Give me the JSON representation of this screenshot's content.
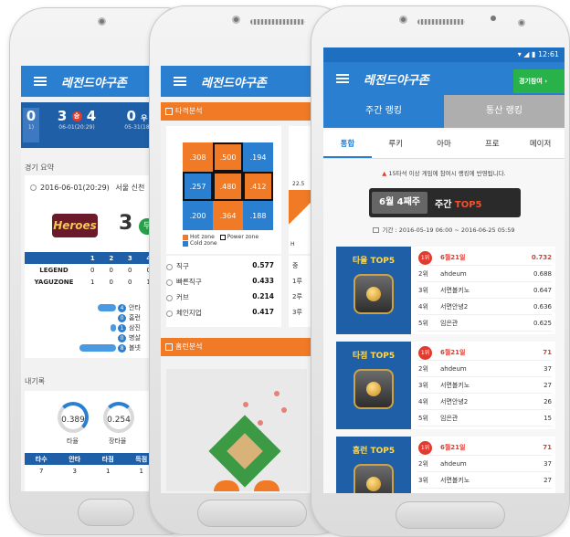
{
  "brand": "레전드야구존",
  "phone1": {
    "score_cards": [
      {
        "score": "0",
        "date": "1)"
      },
      {
        "score_left": "3",
        "result": "승",
        "score_right": "4",
        "date": "06-01(20:29)"
      },
      {
        "score": "0",
        "result": "우",
        "date": "05-31(18"
      }
    ],
    "summary_label": "경기 요약",
    "game_datetime": "2016-06-01(20:29)",
    "game_place": "서울 신천",
    "team_logo": "Heroes",
    "team_score": "3",
    "team_result": "무",
    "innings": [
      "1",
      "2",
      "3",
      "4"
    ],
    "box_rows": [
      {
        "team": "LEGEND",
        "scores": [
          "0",
          "0",
          "0",
          "0"
        ]
      },
      {
        "team": "YAGUZONE",
        "scores": [
          "1",
          "0",
          "0",
          "1"
        ]
      }
    ],
    "stat_legend": [
      {
        "count": "4",
        "label": "안타",
        "fill": 0.5
      },
      {
        "count": "0",
        "label": "홈런",
        "fill": 0
      },
      {
        "count": "1",
        "label": "삼진",
        "fill": 0.15
      },
      {
        "count": "0",
        "label": "병살",
        "fill": 0
      },
      {
        "count": "8",
        "label": "볼넷",
        "fill": 1
      }
    ],
    "my_record_label": "내기록",
    "rings": [
      {
        "value": "0.389",
        "label": "타율"
      },
      {
        "value": "0.254",
        "label": "장타율"
      }
    ],
    "record_headers": [
      "타수",
      "안타",
      "타점",
      "득점"
    ],
    "record_values": [
      "7",
      "3",
      "1",
      "1"
    ]
  },
  "phone2": {
    "batting_section": "타격분석",
    "zones": [
      {
        "value": ".308",
        "type": "hot",
        "power": false
      },
      {
        "value": ".500",
        "type": "hot",
        "power": true
      },
      {
        "value": ".194",
        "type": "cold",
        "power": false
      },
      {
        "value": ".257",
        "type": "cold",
        "power": true
      },
      {
        "value": ".480",
        "type": "hot",
        "power": true
      },
      {
        "value": ".412",
        "type": "hot",
        "power": true
      },
      {
        "value": ".200",
        "type": "cold",
        "power": false
      },
      {
        "value": ".364",
        "type": "hot",
        "power": false
      },
      {
        "value": ".188",
        "type": "cold",
        "power": false
      }
    ],
    "zone_legend": {
      "hot": "Hot zone",
      "power": "Power zone",
      "cold": "Cold zone"
    },
    "pitch_stats": [
      {
        "label": "직구",
        "value": "0.577"
      },
      {
        "label": "빠른직구",
        "value": "0.433"
      },
      {
        "label": "커브",
        "value": "0.214"
      },
      {
        "label": "체인지업",
        "value": "0.417"
      }
    ],
    "side_peek": {
      "value": "22.5",
      "rows": [
        "중",
        "1루",
        "2루",
        "3루"
      ],
      "legend": "H"
    },
    "homerun_section": "홈런분석"
  },
  "phone3": {
    "status_time": "12:61",
    "join_button": "경기참여",
    "main_tabs": [
      "주간 랭킹",
      "통산 랭킹"
    ],
    "sub_tabs": [
      "통합",
      "루키",
      "아마",
      "프로",
      "메이저"
    ],
    "notice": "15타석 이상 게임에 참여시 랭킹에 반영됩니다.",
    "week_label": "6월 4째주",
    "week_title_prefix": "주간",
    "week_title_suffix": "TOP5",
    "period": "기간 : 2016-05-19 06:00 ~ 2016-06-25 05:59",
    "rankings": [
      {
        "title": "타율 TOP5",
        "rows": [
          {
            "rank": "1위",
            "name": "6월21일",
            "value": "0.732"
          },
          {
            "rank": "2위",
            "name": "ahdeum",
            "value": "0.688"
          },
          {
            "rank": "3위",
            "name": "서면볼키노",
            "value": "0.647"
          },
          {
            "rank": "4위",
            "name": "서면안녕2",
            "value": "0.636"
          },
          {
            "rank": "5위",
            "name": "임은관",
            "value": "0.625"
          }
        ]
      },
      {
        "title": "타점 TOP5",
        "rows": [
          {
            "rank": "1위",
            "name": "6월21일",
            "value": "71"
          },
          {
            "rank": "2위",
            "name": "ahdeum",
            "value": "37"
          },
          {
            "rank": "3위",
            "name": "서면볼키노",
            "value": "27"
          },
          {
            "rank": "4위",
            "name": "서면안녕2",
            "value": "26"
          },
          {
            "rank": "5위",
            "name": "임은관",
            "value": "15"
          }
        ]
      },
      {
        "title": "홈런 TOP5",
        "rows": [
          {
            "rank": "1위",
            "name": "6월21일",
            "value": "71"
          },
          {
            "rank": "2위",
            "name": "ahdeum",
            "value": "37"
          },
          {
            "rank": "3위",
            "name": "서면볼키노",
            "value": "27"
          }
        ]
      }
    ]
  },
  "colors": {
    "primary": "#2b7fd0",
    "accent": "#f07a26",
    "win": "#e23b2e",
    "join": "#29b24a"
  }
}
